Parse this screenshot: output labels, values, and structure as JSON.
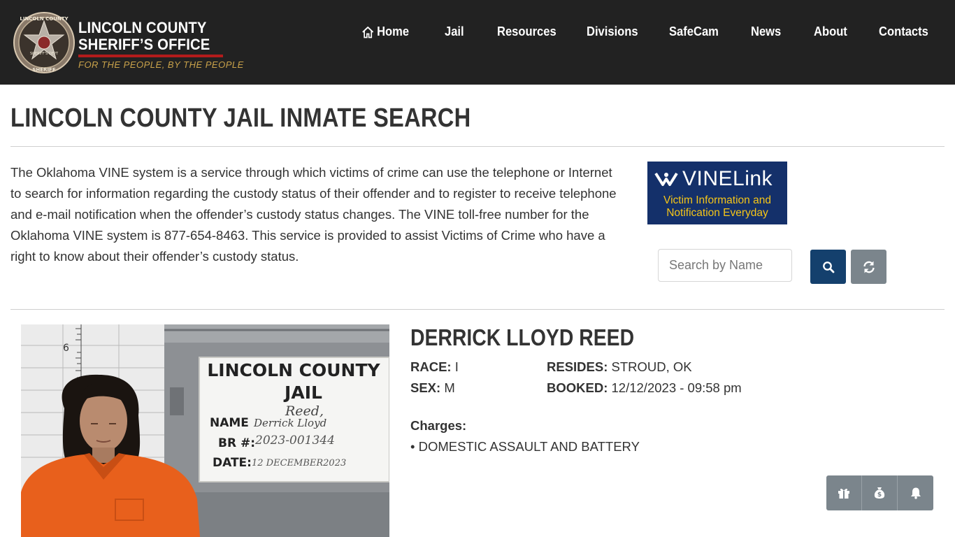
{
  "header": {
    "logo": {
      "line1": "LINCOLN COUNTY",
      "line2": "SHERIFF’S OFFICE",
      "tagline": "FOR THE PEOPLE, BY THE PEOPLE",
      "badge_text_top": "LINCOLN COUNTY",
      "badge_text_bottom": "SHERIFF",
      "badge_text_center": "SHERIFF'S DEPT"
    },
    "nav": [
      {
        "label": "Home",
        "icon": "home-icon"
      },
      {
        "label": "Jail"
      },
      {
        "label": "Resources"
      },
      {
        "label": "Divisions"
      },
      {
        "label": "SafeCam"
      },
      {
        "label": "News"
      },
      {
        "label": "About"
      },
      {
        "label": "Contacts"
      }
    ]
  },
  "page": {
    "title": "LINCOLN COUNTY JAIL INMATE SEARCH",
    "intro": "The Oklahoma VINE system is a service through which victims of crime can use the telephone or Internet to search for information regarding the custody status of their offender and to register to receive telephone and e-mail notification when the offender’s custody status changes. The VINE toll-free number for the Oklahoma VINE system is 877-654-8463. This service is provided to assist Victims of Crime who have a right to know about their offender’s custody status."
  },
  "vinelink": {
    "brand": "VINELink",
    "sub_line1": "Victim Information and",
    "sub_line2": "Notification Everyday"
  },
  "search": {
    "placeholder": "Search by Name",
    "value": ""
  },
  "inmate": {
    "name": "DERRICK LLOYD REED",
    "race_label": "RACE:",
    "race": "I",
    "sex_label": "SEX:",
    "sex": "M",
    "resides_label": "RESIDES:",
    "resides": "STROUD, OK",
    "booked_label": "BOOKED:",
    "booked": "12/12/2023 - 09:58 pm",
    "charges_label": "Charges:",
    "charges": [
      "• DOMESTIC ASSAULT AND BATTERY"
    ],
    "photo_sign": {
      "line1": "LINCOLN COUNTY",
      "line2": "JAIL",
      "surname": "Reed,",
      "name_label": "NAME",
      "name_value": "Derrick Lloyd",
      "br_label": "BR #:",
      "br_value": "2023-001344",
      "date_label": "DATE:",
      "date_value": "12 DECEMBER2023",
      "height_mark": "6"
    }
  },
  "actions": [
    {
      "icon": "gift-icon"
    },
    {
      "icon": "money-bag-icon"
    },
    {
      "icon": "bell-icon"
    }
  ],
  "colors": {
    "header_bg": "#222222",
    "primary_button": "#14406d",
    "secondary_button": "#7b858c",
    "vine_bg": "#14306a",
    "vine_accent": "#f5c518",
    "brand_red": "#b31b1b",
    "tagline_gold": "#c9a24a"
  }
}
